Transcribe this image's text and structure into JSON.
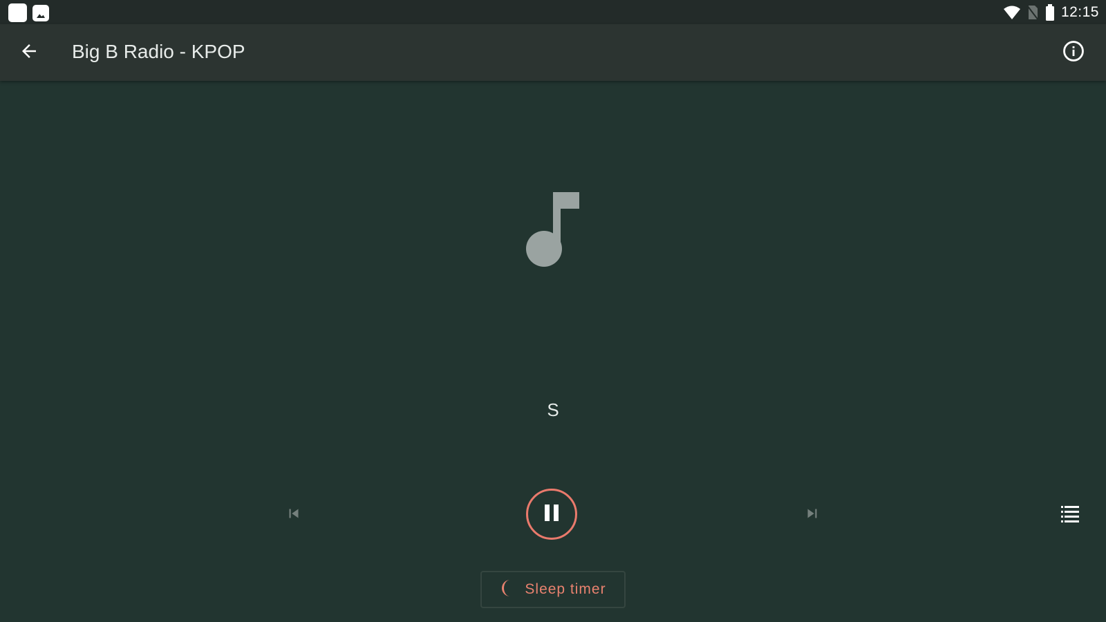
{
  "status_bar": {
    "time": "12:15",
    "icons": [
      "notification-app-icon",
      "notification-image-icon",
      "wifi-icon",
      "no-sim-icon",
      "battery-icon"
    ]
  },
  "app_bar": {
    "title": "Big B Radio - KPOP",
    "back_icon": "arrow-back-icon",
    "info_icon": "info-icon"
  },
  "player": {
    "art_icon": "music-note-icon",
    "track_text": "S",
    "controls": {
      "previous_icon": "skip-previous-icon",
      "play_pause_icon": "pause-icon",
      "next_icon": "skip-next-icon",
      "queue_icon": "queue-list-icon"
    },
    "sleep_timer": {
      "label": "Sleep timer",
      "icon": "moon-icon"
    }
  },
  "colors": {
    "background": "#223530",
    "app_bar": "#2c3431",
    "status_bar": "#232b29",
    "accent": "#ea7a6c",
    "art_icon": "#9aa3a1",
    "disabled_control": "#75807d"
  }
}
